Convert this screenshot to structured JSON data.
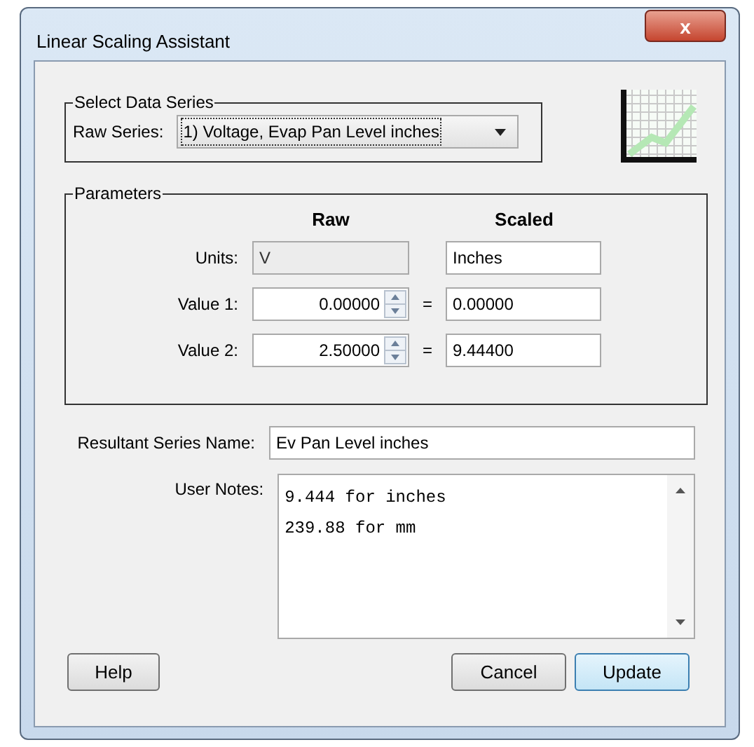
{
  "window": {
    "title": "Linear Scaling Assistant",
    "close_label": "x"
  },
  "select_group": {
    "legend": "Select Data Series",
    "label": "Raw Series:",
    "value": "1) Voltage, Evap Pan Level inches"
  },
  "parameters": {
    "legend": "Parameters",
    "headers": [
      "Raw",
      "Scaled"
    ],
    "rows": [
      {
        "label": "Units:",
        "raw": {
          "value": "V",
          "kind": "text",
          "disabled": true
        },
        "scaled": "Inches",
        "equals": ""
      },
      {
        "label": "Value 1:",
        "raw": {
          "value": "0.00000",
          "kind": "spinner",
          "disabled": false
        },
        "scaled": "0.00000",
        "equals": "="
      },
      {
        "label": "Value 2:",
        "raw": {
          "value": "2.50000",
          "kind": "spinner",
          "disabled": false
        },
        "scaled": "9.44400",
        "equals": "="
      }
    ]
  },
  "resultant": {
    "label": "Resultant Series Name:",
    "value": "Ev Pan Level inches"
  },
  "notes": {
    "label": "User Notes:",
    "lines": [
      "9.444 for inches",
      "239.88 for mm"
    ]
  },
  "buttons": {
    "left": [
      {
        "label": "Help",
        "default": false
      }
    ],
    "right": [
      {
        "label": "Cancel",
        "default": false
      },
      {
        "label": "Update",
        "default": true
      }
    ]
  }
}
